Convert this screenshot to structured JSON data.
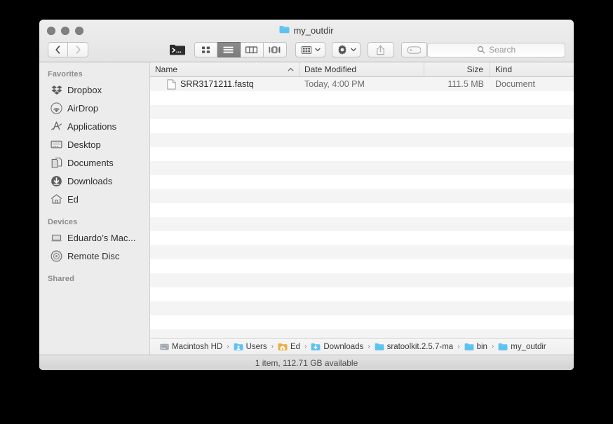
{
  "window": {
    "title": "my_outdir",
    "title_icon": "blue-folder-icon",
    "traffic_lights": [
      "close-button",
      "minimize-button",
      "zoom-button"
    ]
  },
  "toolbar": {
    "back_label": "‹",
    "forward_label": "›",
    "terminal_icon": "terminal-folder-icon",
    "view_modes": [
      {
        "name": "icon-view",
        "icon": "grid-icon",
        "active": false
      },
      {
        "name": "list-view",
        "icon": "list-icon",
        "active": true
      },
      {
        "name": "column-view",
        "icon": "columns-icon",
        "active": false
      },
      {
        "name": "coverflow-view",
        "icon": "coverflow-icon",
        "active": false
      }
    ],
    "arrange_icon": "arrange-grid-icon",
    "action_icon": "gear-icon",
    "share_icon": "share-icon",
    "tag_icon": "tag-icon"
  },
  "search": {
    "placeholder": "Search",
    "value": "",
    "icon": "search-icon"
  },
  "sidebar": {
    "sections": [
      {
        "header": "Favorites",
        "items": [
          {
            "label": "Dropbox",
            "icon": "dropbox-icon"
          },
          {
            "label": "AirDrop",
            "icon": "airdrop-icon"
          },
          {
            "label": "Applications",
            "icon": "applications-icon"
          },
          {
            "label": "Desktop",
            "icon": "desktop-icon"
          },
          {
            "label": "Documents",
            "icon": "documents-icon"
          },
          {
            "label": "Downloads",
            "icon": "downloads-icon"
          },
          {
            "label": "Ed",
            "icon": "home-icon"
          }
        ]
      },
      {
        "header": "Devices",
        "items": [
          {
            "label": "Eduardo’s Mac...",
            "icon": "laptop-icon"
          },
          {
            "label": "Remote Disc",
            "icon": "disc-icon"
          }
        ]
      },
      {
        "header": "Shared",
        "items": []
      }
    ]
  },
  "filelist": {
    "columns": [
      {
        "label": "Name",
        "sort": "ascending"
      },
      {
        "label": "Date Modified",
        "sort": null
      },
      {
        "label": "Size",
        "sort": null
      },
      {
        "label": "Kind",
        "sort": null
      }
    ],
    "rows": [
      {
        "icon": "document-file-icon",
        "name": "SRR3171211.fastq",
        "date_modified": "Today, 4:00 PM",
        "size": "111.5 MB",
        "kind": "Document"
      }
    ],
    "empty_row_count": 18
  },
  "pathbar": {
    "crumbs": [
      {
        "label": "Macintosh HD",
        "icon": "harddisk-icon"
      },
      {
        "label": "Users",
        "icon": "users-folder-icon"
      },
      {
        "label": "Ed",
        "icon": "home-folder-icon"
      },
      {
        "label": "Downloads",
        "icon": "downloads-folder-icon"
      },
      {
        "label": "sratoolkit.2.5.7-ma",
        "icon": "blue-folder-icon"
      },
      {
        "label": "bin",
        "icon": "blue-folder-icon"
      },
      {
        "label": "my_outdir",
        "icon": "blue-folder-icon"
      }
    ],
    "separator": "›"
  },
  "statusbar": {
    "text": "1 item, 112.71 GB available"
  },
  "colors": {
    "folder_blue": "#6fc5f0",
    "toolbar_bg": "#e8e8e8",
    "sidebar_bg": "#ececec",
    "row_stripe": "#f4f4f4",
    "selected_segment": "#828282"
  }
}
